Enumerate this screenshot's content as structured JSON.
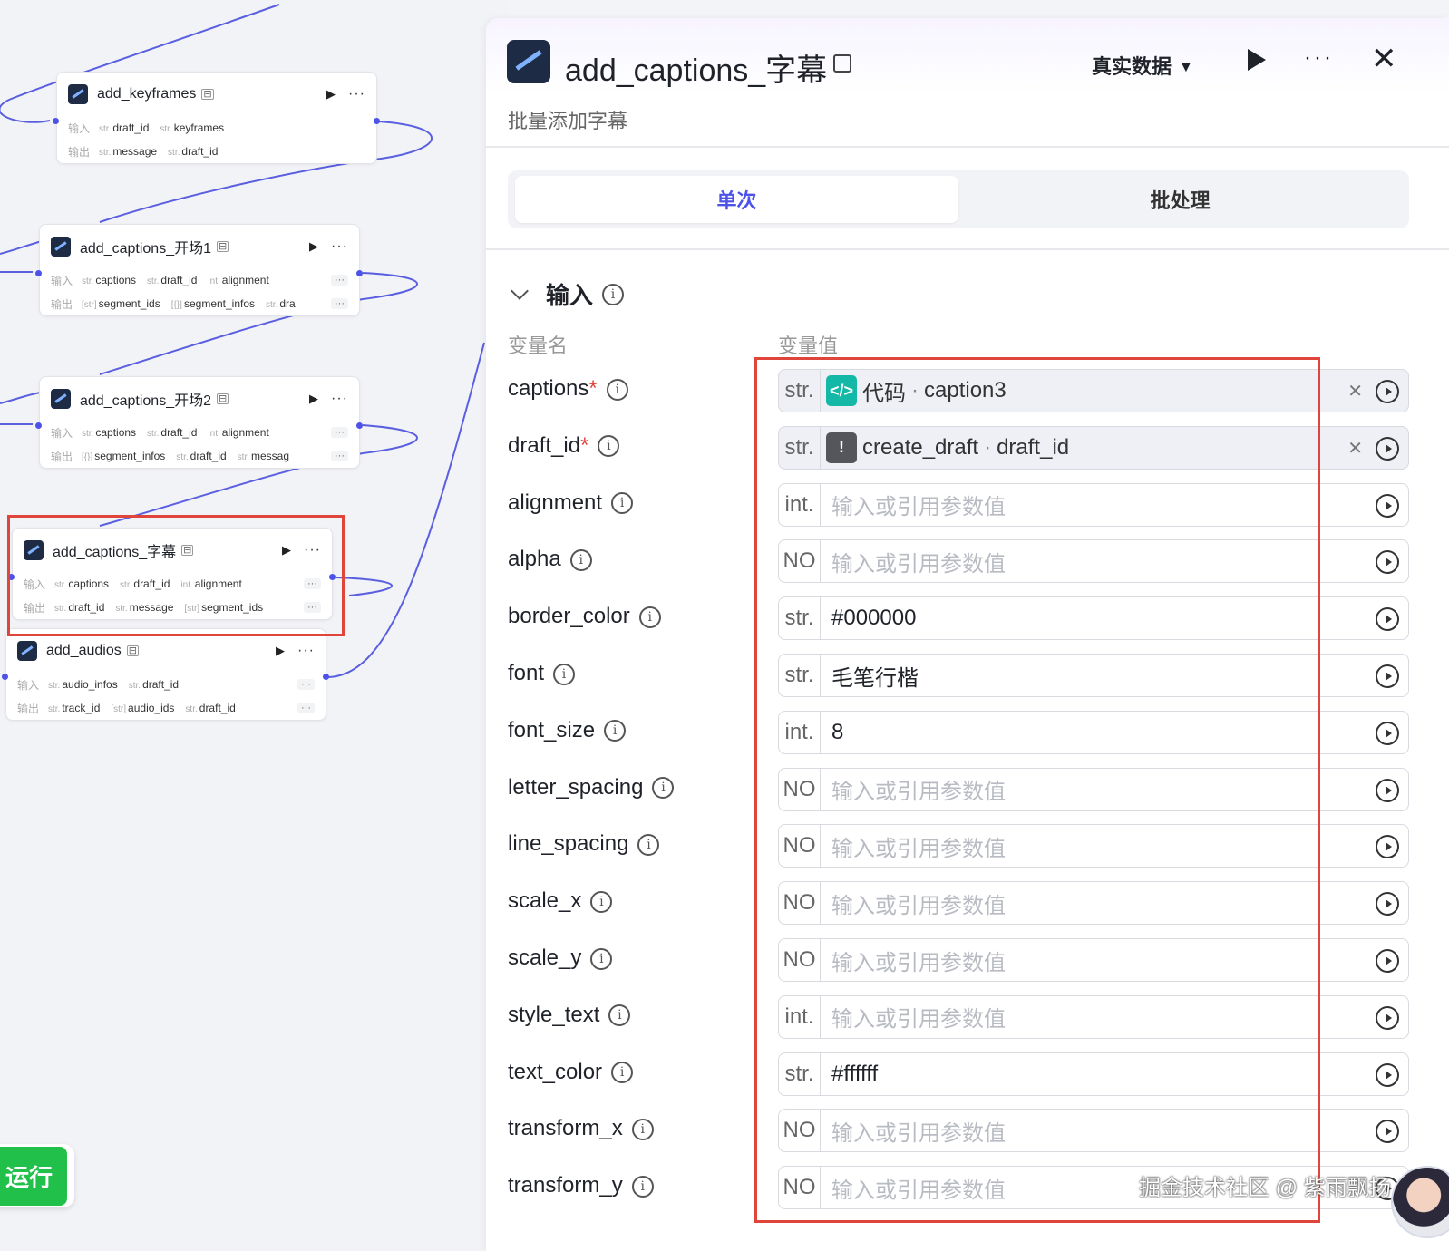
{
  "canvas": {
    "nodes": [
      {
        "title": "add_keyframes",
        "input_label": "输入",
        "output_label": "输出",
        "inputs": [
          {
            "type": "str.",
            "name": "draft_id"
          },
          {
            "type": "str.",
            "name": "keyframes"
          }
        ],
        "outputs": [
          {
            "type": "str.",
            "name": "message"
          },
          {
            "type": "str.",
            "name": "draft_id"
          }
        ]
      },
      {
        "title": "add_captions_开场1",
        "input_label": "输入",
        "output_label": "输出",
        "inputs": [
          {
            "type": "str.",
            "name": "captions"
          },
          {
            "type": "str.",
            "name": "draft_id"
          },
          {
            "type": "int.",
            "name": "alignment"
          }
        ],
        "outputs": [
          {
            "type": "[str]",
            "name": "segment_ids"
          },
          {
            "type": "[{}]",
            "name": "segment_infos"
          },
          {
            "type": "str.",
            "name": "dra"
          }
        ],
        "more": "···"
      },
      {
        "title": "add_captions_开场2",
        "input_label": "输入",
        "output_label": "输出",
        "inputs": [
          {
            "type": "str.",
            "name": "captions"
          },
          {
            "type": "str.",
            "name": "draft_id"
          },
          {
            "type": "int.",
            "name": "alignment"
          }
        ],
        "outputs": [
          {
            "type": "[{}]",
            "name": "segment_infos"
          },
          {
            "type": "str.",
            "name": "draft_id"
          },
          {
            "type": "str.",
            "name": "messag"
          }
        ],
        "more": "···"
      },
      {
        "title": "add_captions_字幕",
        "input_label": "输入",
        "output_label": "输出",
        "inputs": [
          {
            "type": "str.",
            "name": "captions"
          },
          {
            "type": "str.",
            "name": "draft_id"
          },
          {
            "type": "int.",
            "name": "alignment"
          }
        ],
        "outputs": [
          {
            "type": "str.",
            "name": "draft_id"
          },
          {
            "type": "str.",
            "name": "message"
          },
          {
            "type": "[str]",
            "name": "segment_ids"
          }
        ],
        "more": "···"
      },
      {
        "title": "add_audios",
        "input_label": "输入",
        "output_label": "输出",
        "inputs": [
          {
            "type": "str.",
            "name": "audio_infos"
          },
          {
            "type": "str.",
            "name": "draft_id"
          }
        ],
        "outputs": [
          {
            "type": "str.",
            "name": "track_id"
          },
          {
            "type": "[str]",
            "name": "audio_ids"
          },
          {
            "type": "str.",
            "name": "draft_id"
          }
        ],
        "more": "···"
      }
    ],
    "run_button": "运行"
  },
  "panel": {
    "title": "add_captions_字幕",
    "description": "批量添加字幕",
    "data_select": "真实数据",
    "tabs": [
      "单次",
      "批处理"
    ],
    "active_tab": 0,
    "section_title": "输入",
    "col_name": "变量名",
    "col_value": "变量值",
    "params": [
      {
        "name": "captions",
        "required": true,
        "type": "str.",
        "ref": {
          "icon": "code-icon",
          "node": "代码",
          "field": "caption3"
        }
      },
      {
        "name": "draft_id",
        "required": true,
        "type": "str.",
        "ref": {
          "icon": "alert-icon",
          "node": "create_draft",
          "field": "draft_id"
        }
      },
      {
        "name": "alignment",
        "required": false,
        "type": "int.",
        "placeholder": "输入或引用参数值"
      },
      {
        "name": "alpha",
        "required": false,
        "type": "NO",
        "placeholder": "输入或引用参数值"
      },
      {
        "name": "border_color",
        "required": false,
        "type": "str.",
        "value": "#000000"
      },
      {
        "name": "font",
        "required": false,
        "type": "str.",
        "value": "毛笔行楷"
      },
      {
        "name": "font_size",
        "required": false,
        "type": "int.",
        "value": "8"
      },
      {
        "name": "letter_spacing",
        "required": false,
        "type": "NO",
        "placeholder": "输入或引用参数值"
      },
      {
        "name": "line_spacing",
        "required": false,
        "type": "NO",
        "placeholder": "输入或引用参数值"
      },
      {
        "name": "scale_x",
        "required": false,
        "type": "NO",
        "placeholder": "输入或引用参数值"
      },
      {
        "name": "scale_y",
        "required": false,
        "type": "NO",
        "placeholder": "输入或引用参数值"
      },
      {
        "name": "style_text",
        "required": false,
        "type": "int.",
        "placeholder": "输入或引用参数值"
      },
      {
        "name": "text_color",
        "required": false,
        "type": "str.",
        "value": "#ffffff"
      },
      {
        "name": "transform_x",
        "required": false,
        "type": "NO",
        "placeholder": "输入或引用参数值"
      },
      {
        "name": "transform_y",
        "required": false,
        "type": "NO",
        "placeholder": "输入或引用参数值"
      }
    ]
  },
  "watermark": "掘金技术社区 @ 紫雨飘扬",
  "colors": {
    "accent": "#4d53e8",
    "highlight": "#e0453b",
    "run": "#21c04a"
  }
}
